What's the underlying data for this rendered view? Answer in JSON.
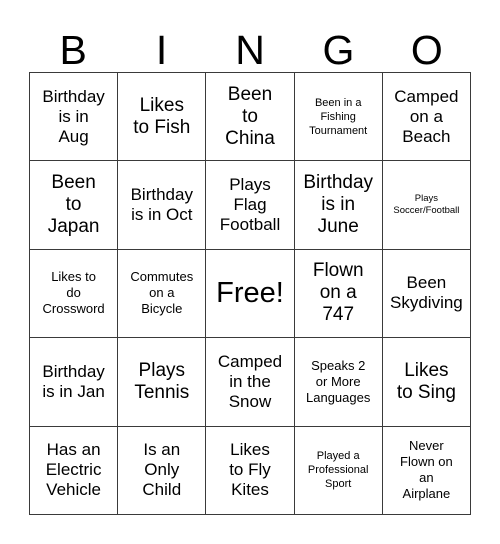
{
  "card": {
    "header_letters": [
      "B",
      "I",
      "N",
      "G",
      "O"
    ],
    "rows": [
      [
        {
          "text": "Birthday\nis in\nAug",
          "size": "size-md"
        },
        {
          "text": "Likes\nto Fish",
          "size": "size-lg"
        },
        {
          "text": "Been\nto\nChina",
          "size": "size-lg"
        },
        {
          "text": "Been in a\nFishing\nTournament",
          "size": "size-xs"
        },
        {
          "text": "Camped\non a\nBeach",
          "size": "size-md"
        }
      ],
      [
        {
          "text": "Been\nto\nJapan",
          "size": "size-lg"
        },
        {
          "text": "Birthday\nis in Oct",
          "size": "size-md"
        },
        {
          "text": "Plays\nFlag\nFootball",
          "size": "size-md"
        },
        {
          "text": "Birthday\nis in\nJune",
          "size": "size-lg"
        },
        {
          "text": "Plays\nSoccer/Football",
          "size": "size-xxs"
        }
      ],
      [
        {
          "text": "Likes to\ndo\nCrossword",
          "size": "size-sm"
        },
        {
          "text": "Commutes\non a\nBicycle",
          "size": "size-sm"
        },
        {
          "text": "Free!",
          "size": "size-xl"
        },
        {
          "text": "Flown\non a\n747",
          "size": "size-lg"
        },
        {
          "text": "Been\nSkydiving",
          "size": "size-md"
        }
      ],
      [
        {
          "text": "Birthday\nis in Jan",
          "size": "size-md"
        },
        {
          "text": "Plays\nTennis",
          "size": "size-lg"
        },
        {
          "text": "Camped\nin the\nSnow",
          "size": "size-md"
        },
        {
          "text": "Speaks 2\nor More\nLanguages",
          "size": "size-sm"
        },
        {
          "text": "Likes\nto Sing",
          "size": "size-lg"
        }
      ],
      [
        {
          "text": "Has an\nElectric\nVehicle",
          "size": "size-md"
        },
        {
          "text": "Is an\nOnly\nChild",
          "size": "size-md"
        },
        {
          "text": "Likes\nto Fly\nKites",
          "size": "size-md"
        },
        {
          "text": "Played a\nProfessional\nSport",
          "size": "size-xs"
        },
        {
          "text": "Never\nFlown on\nan\nAirplane",
          "size": "size-sm"
        }
      ]
    ]
  },
  "colors": {
    "grid_line": "#3a3a3a",
    "text": "#000000",
    "background": "#ffffff"
  }
}
